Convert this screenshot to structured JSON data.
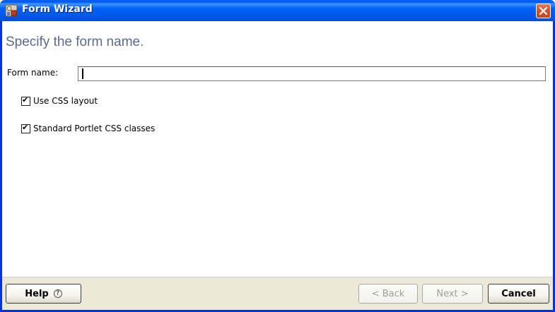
{
  "window": {
    "title": "Form Wizard",
    "icon": "wizard-icon",
    "close_icon": "close-icon",
    "accent": "#0058ee",
    "close_color": "#d8522c"
  },
  "page": {
    "heading": "Specify the form name."
  },
  "form": {
    "name_label": "Form name:",
    "name_value": "",
    "name_placeholder": ""
  },
  "options": {
    "use_css_layout": {
      "label": "Use CSS layout",
      "checked": true
    },
    "portlet_css": {
      "label": "Standard Portlet CSS classes",
      "checked": true
    }
  },
  "buttons": {
    "help": "Help",
    "help_icon": "?",
    "back": "< Back",
    "next": "Next >",
    "cancel": "Cancel"
  }
}
